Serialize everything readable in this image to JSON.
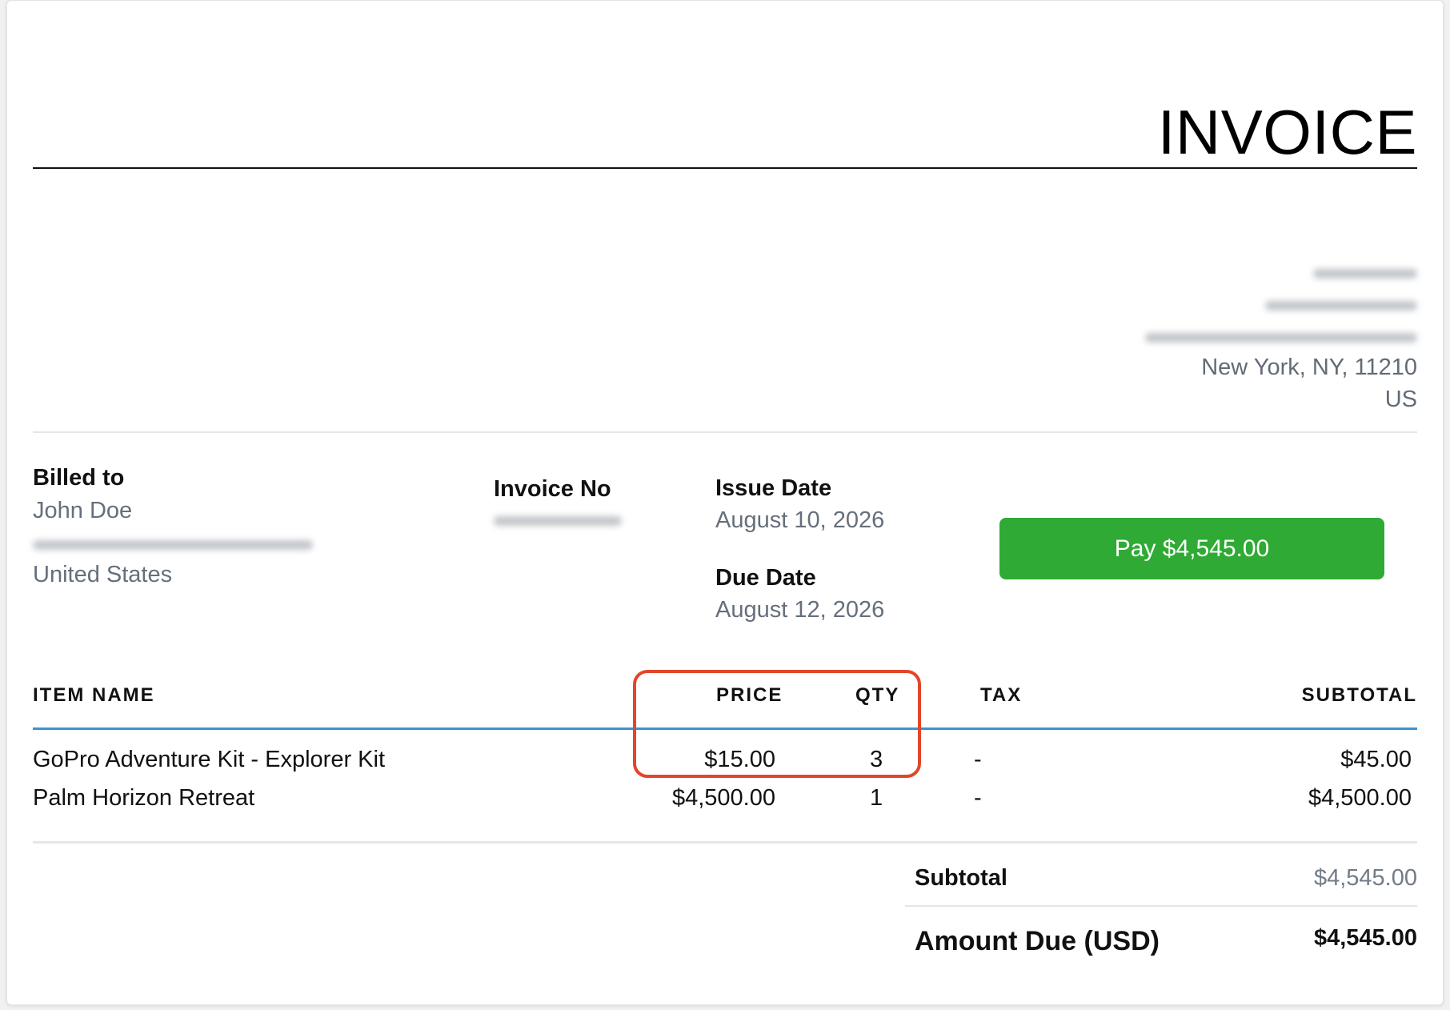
{
  "invoice": {
    "title": "INVOICE"
  },
  "sender_address": {
    "city_line": "New York, NY, 11210",
    "country": "US"
  },
  "billed_to": {
    "label": "Billed to",
    "name": "John Doe",
    "country": "United States"
  },
  "invoice_no": {
    "label": "Invoice No"
  },
  "issue_date": {
    "label": "Issue Date",
    "value": "August 10, 2026"
  },
  "due_date": {
    "label": "Due Date",
    "value": "August 12, 2026"
  },
  "pay_button": {
    "label": "Pay $4,545.00",
    "color": "#2faa34"
  },
  "table": {
    "headers": {
      "item_name": "ITEM NAME",
      "price": "PRICE",
      "qty": "QTY",
      "tax": "TAX",
      "subtotal": "SUBTOTAL"
    },
    "rows": [
      {
        "item": "GoPro Adventure Kit - Explorer Kit",
        "price": "$15.00",
        "qty": "3",
        "tax": "-",
        "subtotal": "$45.00"
      },
      {
        "item": "Palm Horizon Retreat",
        "price": "$4,500.00",
        "qty": "1",
        "tax": "-",
        "subtotal": "$4,500.00"
      }
    ],
    "header_rule_color": "#3b93cf"
  },
  "totals": {
    "subtotal_label": "Subtotal",
    "subtotal_value": "$4,545.00",
    "amount_due_label": "Amount Due (USD)",
    "amount_due_value": "$4,545.00"
  },
  "annotation": {
    "highlight_color": "#e2462a"
  }
}
